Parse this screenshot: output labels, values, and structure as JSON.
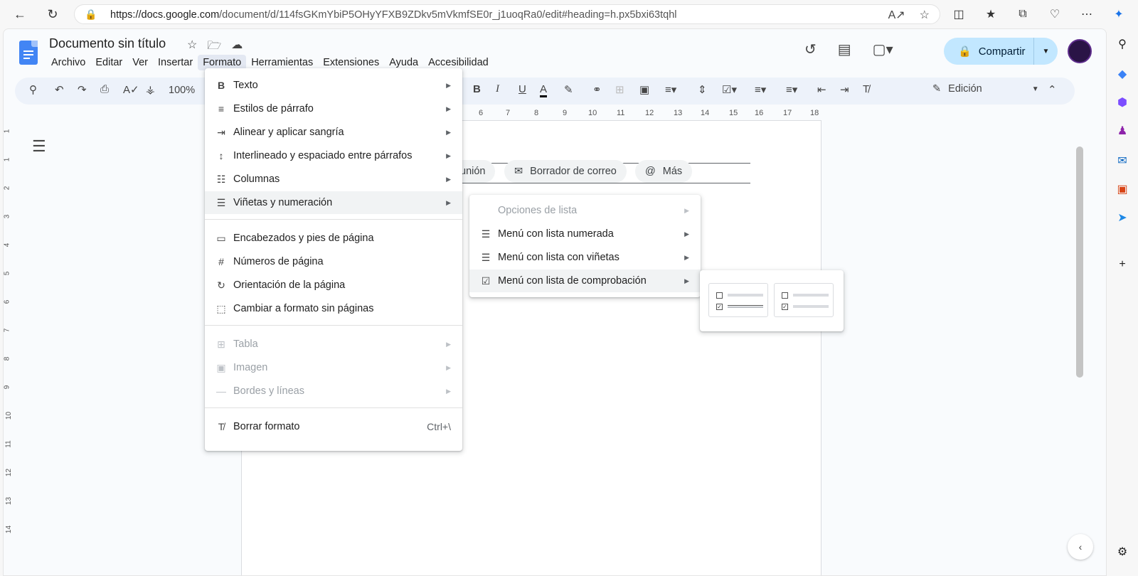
{
  "browser": {
    "url_host": "https://docs.google.com",
    "url_path": "/document/d/114fsGKmYbiP5OHyYFXB9ZDkv5mVkmfSE0r_j1uoqRa0/edit#heading=h.px5bxi63tqhl"
  },
  "doc": {
    "title": "Documento sin título",
    "menu": [
      "Archivo",
      "Editar",
      "Ver",
      "Insertar",
      "Formato",
      "Herramientas",
      "Extensiones",
      "Ayuda",
      "Accesibilidad"
    ],
    "share_label": "Compartir",
    "zoom": "100%",
    "mode_label": "Edición"
  },
  "ruler_numbers": [
    "6",
    "7",
    "8",
    "9",
    "10",
    "11",
    "12",
    "13",
    "14",
    "15",
    "16",
    "17",
    "18"
  ],
  "vruler_numbers": [
    "1",
    "1",
    "2",
    "3",
    "4",
    "5",
    "6",
    "7",
    "8",
    "9",
    "10",
    "11",
    "12",
    "13",
    "14"
  ],
  "chips": {
    "meeting_partial": "unión",
    "email_draft": "Borrador de correo",
    "more": "Más"
  },
  "format_menu": {
    "items": [
      {
        "label": "Texto",
        "icon": "bold-icon"
      },
      {
        "label": "Estilos de párrafo",
        "icon": "paragraph-styles-icon"
      },
      {
        "label": "Alinear y aplicar sangría",
        "icon": "indent-icon"
      },
      {
        "label": "Interlineado y espaciado entre párrafos",
        "icon": "line-spacing-icon"
      },
      {
        "label": "Columnas",
        "icon": "columns-icon"
      },
      {
        "label": "Viñetas y numeración",
        "icon": "bullets-icon"
      },
      {
        "label": "Encabezados y pies de página",
        "icon": "header-footer-icon"
      },
      {
        "label": "Números de página",
        "icon": "hash-icon"
      },
      {
        "label": "Orientación de la página",
        "icon": "orientation-icon"
      },
      {
        "label": "Cambiar a formato sin páginas",
        "icon": "pageless-icon"
      },
      {
        "label": "Tabla",
        "icon": "table-icon"
      },
      {
        "label": "Imagen",
        "icon": "image-icon"
      },
      {
        "label": "Bordes y líneas",
        "icon": "borders-icon"
      },
      {
        "label": "Borrar formato",
        "icon": "clear-format-icon",
        "shortcut": "Ctrl+\\"
      }
    ]
  },
  "bullets_submenu": {
    "items": [
      {
        "label": "Opciones de lista"
      },
      {
        "label": "Menú con lista numerada"
      },
      {
        "label": "Menú con lista con viñetas"
      },
      {
        "label": "Menú con lista de comprobación"
      }
    ]
  }
}
